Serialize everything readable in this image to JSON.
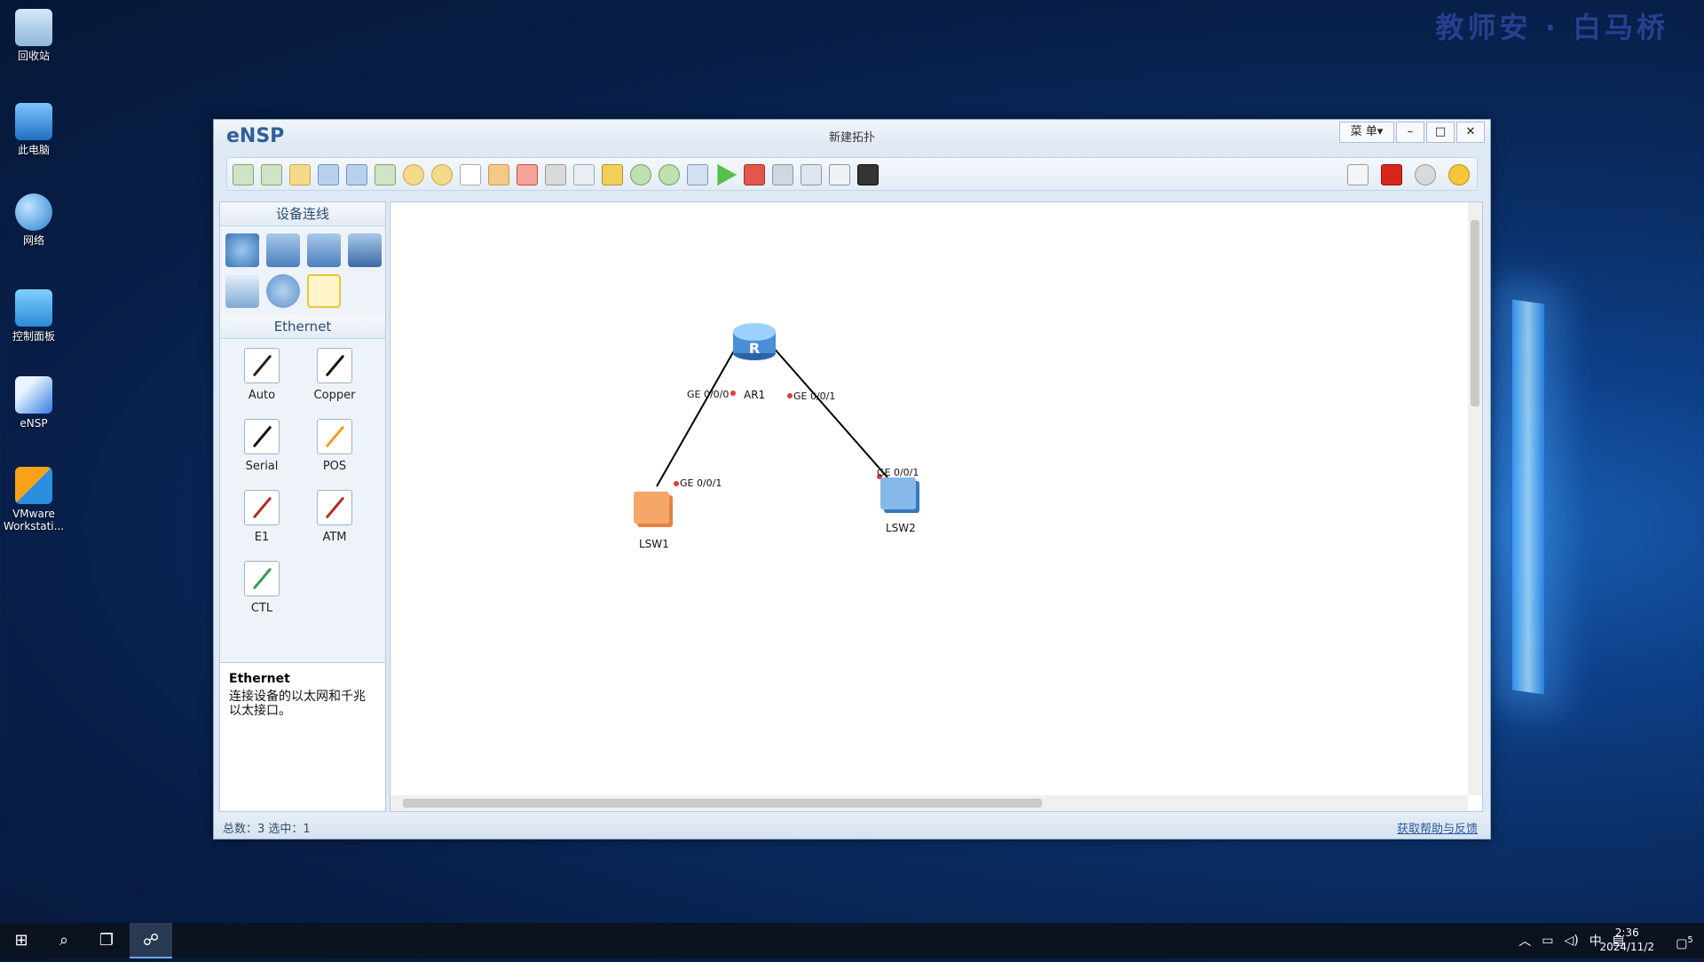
{
  "desktop": {
    "watermark": "教师安 · 白马桥",
    "icons": [
      {
        "name": "recycle-bin",
        "label": "回收站"
      },
      {
        "name": "this-pc",
        "label": "此电脑"
      },
      {
        "name": "network",
        "label": "网络"
      },
      {
        "name": "control-panel",
        "label": "控制面板"
      },
      {
        "name": "ensp",
        "label": "eNSP"
      },
      {
        "name": "vmware",
        "label": "VMware Workstati..."
      }
    ]
  },
  "window": {
    "logo": "eNSP",
    "title": "新建拓扑",
    "menu_label": "菜 单▾",
    "minimize": "–",
    "maximize": "□",
    "close": "✕"
  },
  "left_panel": {
    "device_header": "设备连线",
    "cable_header": "Ethernet",
    "cables": [
      {
        "label": "Auto",
        "color": "#222222"
      },
      {
        "label": "Copper",
        "color": "#111111"
      },
      {
        "label": "Serial",
        "color": "#111111"
      },
      {
        "label": "POS",
        "color": "#f39a2b"
      },
      {
        "label": "E1",
        "color": "#b42b1f"
      },
      {
        "label": "ATM",
        "color": "#b42b1f"
      },
      {
        "label": "CTL",
        "color": "#3a9b52"
      }
    ],
    "desc_title": "Ethernet",
    "desc_text": "连接设备的以太网和千兆以太接口。"
  },
  "topology": {
    "nodes": [
      {
        "id": "AR1",
        "label": "AR1",
        "type": "router"
      },
      {
        "id": "LSW1",
        "label": "LSW1",
        "type": "switch-orange"
      },
      {
        "id": "LSW2",
        "label": "LSW2",
        "type": "switch-blue"
      }
    ],
    "links": [
      {
        "a": "AR1",
        "a_port": "GE 0/0/0",
        "b": "LSW1",
        "b_port": "GE 0/0/1"
      },
      {
        "a": "AR1",
        "a_port": "GE 0/0/1",
        "b": "LSW2",
        "b_port": "GE 0/0/1"
      }
    ]
  },
  "status": {
    "summary": "总数：3  选中：1",
    "help": "获取帮助与反馈"
  },
  "taskbar": {
    "time": "2:36",
    "date": "2024/11/2",
    "ime": "中",
    "notifications": "5"
  }
}
